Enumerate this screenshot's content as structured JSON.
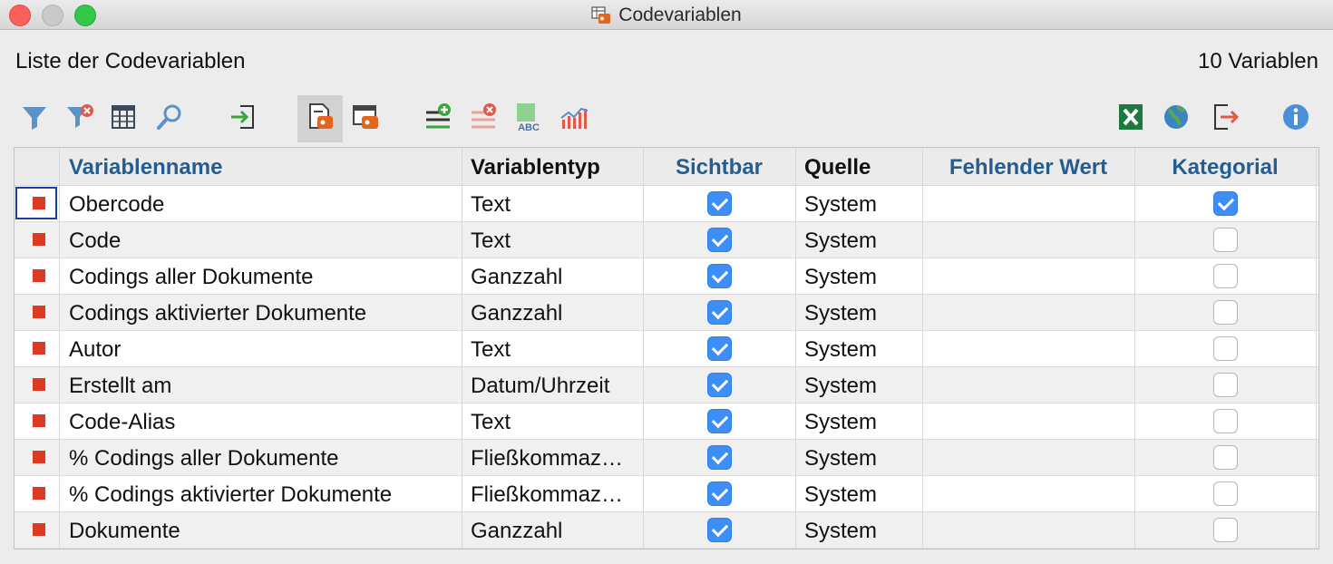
{
  "window": {
    "title": "Codevariablen",
    "list_label": "Liste der Codevariablen",
    "count_label": "10 Variablen"
  },
  "toolbar": {
    "left": [
      {
        "name": "filter-icon",
        "color": "#5b93c9"
      },
      {
        "name": "remove-filter-icon",
        "color": "#e05a4a"
      },
      {
        "name": "columns-icon",
        "color": "#3a4a5a"
      },
      {
        "name": "search-icon",
        "color": "#5b93c9"
      },
      {
        "name": "import-icon",
        "color": "#3aa53a"
      },
      {
        "name": "code-variables-icon",
        "color": "#e4661c"
      },
      {
        "name": "variable-list-icon",
        "color": "#e4661c"
      },
      {
        "name": "add-variable-icon",
        "color": "#3aa53a"
      },
      {
        "name": "delete-variable-icon",
        "color": "#e05a4a"
      },
      {
        "name": "rename-variable-icon",
        "color": "#3aa53a"
      },
      {
        "name": "statistics-icon",
        "color": "#e05a4a"
      }
    ],
    "right": [
      {
        "name": "excel-export-icon",
        "color": "#1d7a3e"
      },
      {
        "name": "web-export-icon",
        "color": "#3a83c4"
      },
      {
        "name": "export-icon",
        "color": "#e05a4a"
      },
      {
        "name": "info-icon",
        "color": "#4a90d9"
      }
    ]
  },
  "table": {
    "columns": [
      "Variablenname",
      "Variablentyp",
      "Sichtbar",
      "Quelle",
      "Fehlender Wert",
      "Kategorial"
    ],
    "rows": [
      {
        "name": "Obercode",
        "type": "Text",
        "visible": true,
        "source": "System",
        "missing": "",
        "categorical": true
      },
      {
        "name": "Code",
        "type": "Text",
        "visible": true,
        "source": "System",
        "missing": "",
        "categorical": false
      },
      {
        "name": "Codings aller Dokumente",
        "type": "Ganzzahl",
        "visible": true,
        "source": "System",
        "missing": "",
        "categorical": false
      },
      {
        "name": "Codings aktivierter Dokumente",
        "type": "Ganzzahl",
        "visible": true,
        "source": "System",
        "missing": "",
        "categorical": false
      },
      {
        "name": "Autor",
        "type": "Text",
        "visible": true,
        "source": "System",
        "missing": "",
        "categorical": false
      },
      {
        "name": "Erstellt am",
        "type": "Datum/Uhrzeit",
        "visible": true,
        "source": "System",
        "missing": "",
        "categorical": false
      },
      {
        "name": "Code-Alias",
        "type": "Text",
        "visible": true,
        "source": "System",
        "missing": "",
        "categorical": false
      },
      {
        "name": "% Codings aller Dokumente",
        "type": "Fließkommaz…",
        "visible": true,
        "source": "System",
        "missing": "",
        "categorical": false
      },
      {
        "name": "% Codings aktivierter Dokumente",
        "type": "Fließkommaz…",
        "visible": true,
        "source": "System",
        "missing": "",
        "categorical": false
      },
      {
        "name": "Dokumente",
        "type": "Ganzzahl",
        "visible": true,
        "source": "System",
        "missing": "",
        "categorical": false
      }
    ],
    "selected_row": 0,
    "marker_color": "#dd3a24",
    "checkbox_color": "#3e8ef7"
  }
}
